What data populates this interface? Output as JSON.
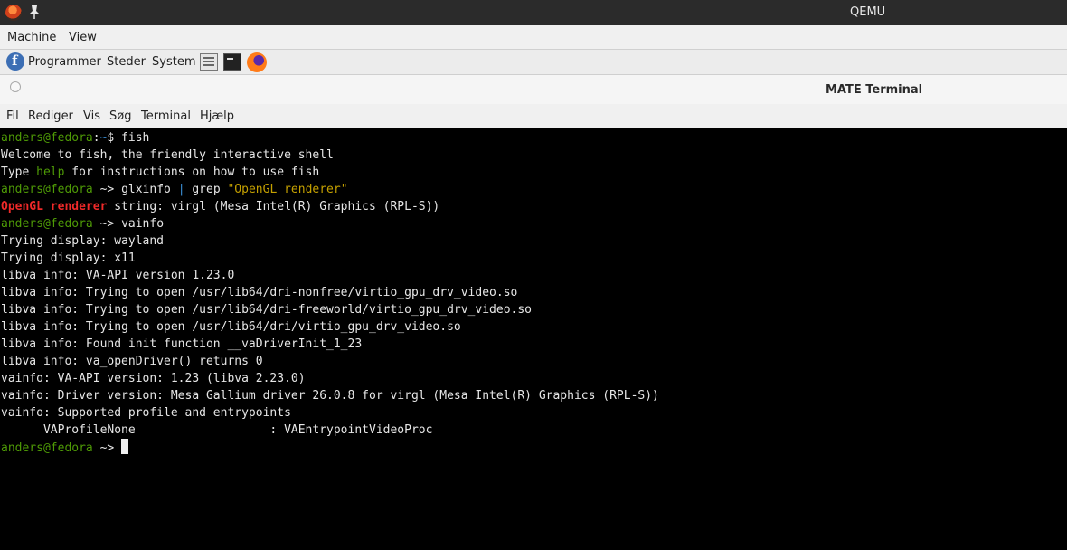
{
  "qemu": {
    "window_title": "QEMU",
    "menu": [
      "Machine",
      "View"
    ]
  },
  "panel": {
    "items": [
      "Programmer",
      "Steder",
      "System"
    ],
    "launchers": [
      "files-icon",
      "terminal-icon",
      "firefox-icon"
    ]
  },
  "terminal_window": {
    "title": "MATE Terminal",
    "menu": [
      "Fil",
      "Rediger",
      "Vis",
      "Søg",
      "Terminal",
      "Hjælp"
    ]
  },
  "terminal": {
    "lines": [
      {
        "segments": [
          {
            "text": "anders@fedora",
            "color": "green"
          },
          {
            "text": ":",
            "color": "white"
          },
          {
            "text": "~",
            "color": "cyan"
          },
          {
            "text": "$ fish",
            "color": "white"
          }
        ]
      },
      {
        "segments": [
          {
            "text": "Welcome to fish, the friendly interactive shell",
            "color": "white"
          }
        ]
      },
      {
        "segments": [
          {
            "text": "Type ",
            "color": "white"
          },
          {
            "text": "help",
            "color": "green"
          },
          {
            "text": " for instructions on how to use fish",
            "color": "white"
          }
        ]
      },
      {
        "segments": [
          {
            "text": "anders@fedora",
            "color": "green"
          },
          {
            "text": " ~> ",
            "color": "white"
          },
          {
            "text": "glxinfo ",
            "color": "white"
          },
          {
            "text": "|",
            "color": "cyan"
          },
          {
            "text": " grep ",
            "color": "white"
          },
          {
            "text": "\"OpenGL renderer\"",
            "color": "yellow"
          }
        ]
      },
      {
        "segments": [
          {
            "text": "OpenGL renderer",
            "color": "red"
          },
          {
            "text": " string: virgl (Mesa Intel(R) Graphics (RPL-S))",
            "color": "white"
          }
        ]
      },
      {
        "segments": [
          {
            "text": "anders@fedora",
            "color": "green"
          },
          {
            "text": " ~> ",
            "color": "white"
          },
          {
            "text": "vainfo",
            "color": "white"
          }
        ]
      },
      {
        "segments": [
          {
            "text": "Trying display: wayland",
            "color": "white"
          }
        ]
      },
      {
        "segments": [
          {
            "text": "Trying display: x11",
            "color": "white"
          }
        ]
      },
      {
        "segments": [
          {
            "text": "libva info: VA-API version 1.23.0",
            "color": "white"
          }
        ]
      },
      {
        "segments": [
          {
            "text": "libva info: Trying to open /usr/lib64/dri-nonfree/virtio_gpu_drv_video.so",
            "color": "white"
          }
        ]
      },
      {
        "segments": [
          {
            "text": "libva info: Trying to open /usr/lib64/dri-freeworld/virtio_gpu_drv_video.so",
            "color": "white"
          }
        ]
      },
      {
        "segments": [
          {
            "text": "libva info: Trying to open /usr/lib64/dri/virtio_gpu_drv_video.so",
            "color": "white"
          }
        ]
      },
      {
        "segments": [
          {
            "text": "libva info: Found init function __vaDriverInit_1_23",
            "color": "white"
          }
        ]
      },
      {
        "segments": [
          {
            "text": "libva info: va_openDriver() returns 0",
            "color": "white"
          }
        ]
      },
      {
        "segments": [
          {
            "text": "vainfo: VA-API version: 1.23 (libva 2.23.0)",
            "color": "white"
          }
        ]
      },
      {
        "segments": [
          {
            "text": "vainfo: Driver version: Mesa Gallium driver 26.0.8 for virgl (Mesa Intel(R) Graphics (RPL-S))",
            "color": "white"
          }
        ]
      },
      {
        "segments": [
          {
            "text": "vainfo: Supported profile and entrypoints",
            "color": "white"
          }
        ]
      },
      {
        "segments": [
          {
            "text": "      VAProfileNone                   : VAEntrypointVideoProc",
            "color": "white"
          }
        ]
      },
      {
        "segments": [
          {
            "text": "anders@fedora",
            "color": "green"
          },
          {
            "text": " ~> ",
            "color": "white"
          }
        ],
        "cursor": true
      }
    ]
  }
}
